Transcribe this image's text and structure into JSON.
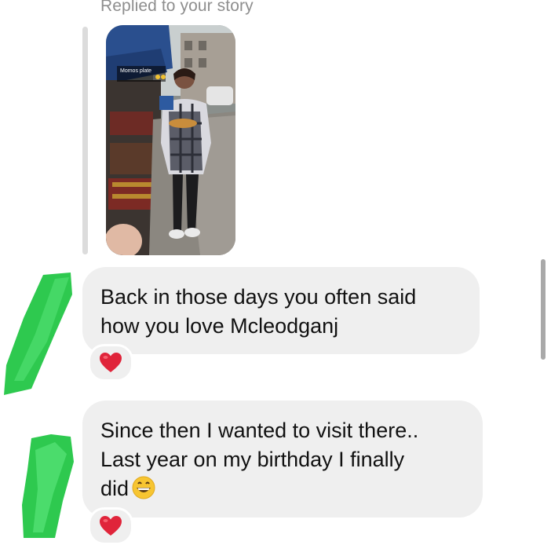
{
  "thread": {
    "replied_label": "Replied to your story",
    "story_caption": "Momos plate",
    "messages": [
      {
        "line1": "Back in those days you often said",
        "line2": "how you love Mcleodganj",
        "reaction_icon": "heart-emoji"
      },
      {
        "line1": "Since then I wanted to visit there..",
        "line2": "Last year on my birthday I finally",
        "line3": "did",
        "inline_emoji": "grinning-face-emoji",
        "reaction_icon": "heart-emoji"
      }
    ]
  },
  "colors": {
    "bubble": "#efefef",
    "secondary_text": "#8e8e8e",
    "redaction": "#2ec94f",
    "heart": "#e0243a"
  }
}
